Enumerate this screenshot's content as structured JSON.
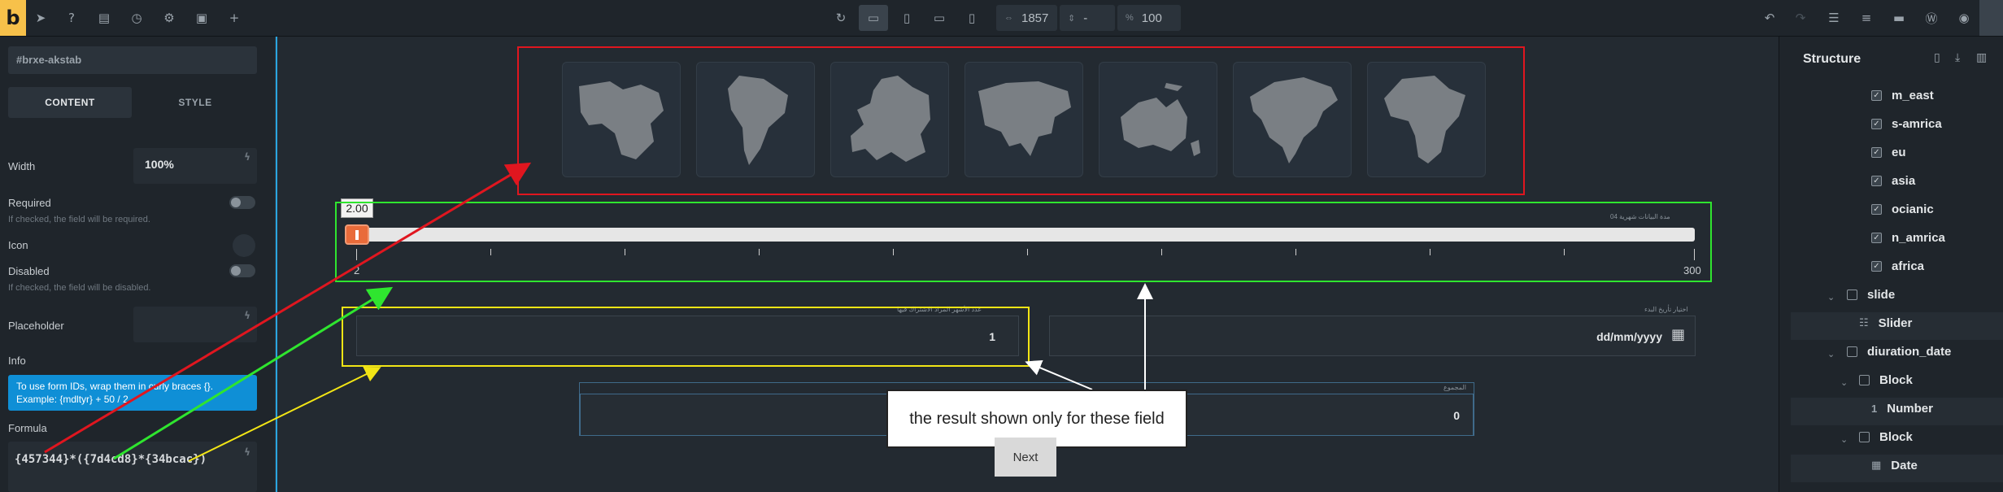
{
  "toolbar": {
    "logo": "b",
    "width_value": "1857",
    "height_value": "-",
    "zoom_value": "100",
    "width_prefix": "⇔",
    "height_prefix": "⇕",
    "zoom_prefix": "%"
  },
  "left_panel": {
    "element_id": "#brxe-akstab",
    "tab_content": "CONTENT",
    "tab_style": "STYLE",
    "width_label": "Width",
    "width_value": "100%",
    "required_label": "Required",
    "required_help": "If checked, the field will be required.",
    "icon_label": "Icon",
    "disabled_label": "Disabled",
    "disabled_help": "If checked, the field will be disabled.",
    "placeholder_label": "Placeholder",
    "info_label": "Info",
    "info_text_1": "To use form IDs, wrap them in curly braces {}.",
    "info_text_2": "Example: {mdltyr} + 50 / 2",
    "formula_label": "Formula",
    "formula_value": "{457344}*({7d4cd8}*{34bcac})"
  },
  "canvas": {
    "maps": [
      "middle-east",
      "south-america",
      "europe",
      "asia",
      "oceania",
      "north-america",
      "africa"
    ],
    "slider": {
      "label": "مدة البيانات شهرية 04",
      "tooltip": "2.00",
      "min_label": "2",
      "max_label": "300",
      "value": 2,
      "min": 2,
      "max": 300
    },
    "field_months": {
      "label": "عدد الأشهر المراد الاشتراك فيها",
      "value": "1"
    },
    "field_date": {
      "label": "اختيار تأريخ البدء",
      "value": "dd/mm/yyyy"
    },
    "field_total": {
      "label": "المجموع",
      "value": "0"
    },
    "callout_text": "the result shown only for these field",
    "next_button": "Next"
  },
  "annotation_colors": {
    "red": "#e0161f",
    "green": "#2fe52f",
    "yellow": "#f2e515",
    "white": "#ffffff"
  },
  "structure": {
    "title": "Structure",
    "items": [
      {
        "label": "m_east",
        "type": "checkbox"
      },
      {
        "label": "s-amrica",
        "type": "checkbox"
      },
      {
        "label": "eu",
        "type": "checkbox"
      },
      {
        "label": "asia",
        "type": "checkbox"
      },
      {
        "label": "ocianic",
        "type": "checkbox"
      },
      {
        "label": "n_amrica",
        "type": "checkbox"
      },
      {
        "label": "africa",
        "type": "checkbox"
      },
      {
        "label": "slide",
        "type": "block"
      },
      {
        "label": "Slider",
        "type": "slider"
      },
      {
        "label": "diuration_date",
        "type": "block"
      },
      {
        "label": "Block",
        "type": "block"
      },
      {
        "label": "Number",
        "type": "number"
      },
      {
        "label": "Block",
        "type": "block"
      },
      {
        "label": "Date",
        "type": "date"
      }
    ]
  }
}
